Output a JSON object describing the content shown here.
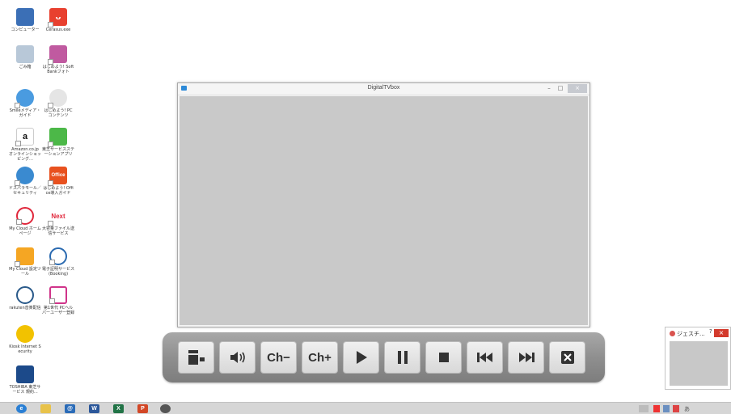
{
  "desktop": {
    "icons": [
      {
        "label": "コンピューター",
        "glyph": "",
        "color": "#3b6fb6",
        "badge": ""
      },
      {
        "label": "Cerasus.exe",
        "glyph": "ᴗ",
        "color": "#e8402f",
        "badge": "↗"
      },
      {
        "label": "ごみ箱",
        "glyph": "",
        "color": "#b8c8d8",
        "badge": ""
      },
      {
        "label": "はじめよう! SoftBankフォト",
        "glyph": "",
        "color": "#c05aa0",
        "badge": "↗"
      },
      {
        "label": "Smileメディア・ガイド",
        "glyph": "",
        "color": "#4a9be0",
        "badge": "↗"
      },
      {
        "label": "はじめよう! PCコンテンツ",
        "glyph": "",
        "color": "#e5e5e5",
        "badge": "↗"
      },
      {
        "label": "Amazon.co.jp オンラインショッピング…",
        "glyph": "a",
        "color": "#ffffff",
        "badge": "↗"
      },
      {
        "label": "東芝サービスステーションアプリ",
        "glyph": "",
        "color": "#4cb848",
        "badge": "↗"
      },
      {
        "label": "ドスパラモール／セキュリティ",
        "glyph": "",
        "color": "#3a8ad0",
        "badge": "↗"
      },
      {
        "label": "はじめよう! Office導入ガイド",
        "glyph": "",
        "color": "#e8511f",
        "badge": "↗"
      },
      {
        "label": "My Cloud ホームページ",
        "glyph": "",
        "color": "#e0283c",
        "badge": "↗"
      },
      {
        "label": "大容量ファイル送信サービス",
        "glyph": "Next",
        "color": "#ffffff",
        "badge": "↗"
      },
      {
        "label": "My Cloud 設定ツール",
        "glyph": "",
        "color": "#f5a623",
        "badge": "↗"
      },
      {
        "label": "電子証明サービス(Booking)",
        "glyph": "",
        "color": "#2a6ab0",
        "badge": "↗"
      },
      {
        "label": "rakuten音楽配信",
        "glyph": "",
        "color": "#2a5a8a",
        "badge": ""
      },
      {
        "label": "第1世代 PCヘルパーユーザー登録",
        "glyph": "",
        "color": "#d0348a",
        "badge": "↗"
      },
      {
        "label": "Kiosk Internet Security",
        "glyph": "",
        "color": "#f2c200",
        "badge": ""
      },
      {
        "label": "TOSHIBA 東芝サービス 規約...",
        "glyph": "",
        "color": "#1c4a8a",
        "badge": ""
      }
    ]
  },
  "window": {
    "title": "DigitalTVbox",
    "minimize_glyph": "–",
    "maximize_glyph": "□",
    "close_glyph": "×"
  },
  "controls": {
    "buttons": [
      {
        "name": "layout-button",
        "label": "",
        "icon": "layout-icon"
      },
      {
        "name": "volume-button",
        "label": "",
        "icon": "speaker-icon"
      },
      {
        "name": "channel-down-button",
        "label": "Ch−",
        "icon": ""
      },
      {
        "name": "channel-up-button",
        "label": "Ch+",
        "icon": ""
      },
      {
        "name": "play-button",
        "label": "",
        "icon": "play-icon"
      },
      {
        "name": "pause-button",
        "label": "",
        "icon": "pause-icon"
      },
      {
        "name": "stop-button",
        "label": "",
        "icon": "stop-icon"
      },
      {
        "name": "previous-button",
        "label": "",
        "icon": "rewind-icon"
      },
      {
        "name": "next-button",
        "label": "",
        "icon": "fast-forward-icon"
      },
      {
        "name": "close-player-button",
        "label": "",
        "icon": "close-icon"
      }
    ]
  },
  "notification": {
    "title": "ジェスチ...",
    "help_glyph": "?",
    "close_glyph": "×"
  },
  "taskbar": {
    "apps": [
      {
        "name": "ie-icon",
        "color": "#2a7fd4",
        "glyph": "e"
      },
      {
        "name": "explorer-icon",
        "color": "#e8c24a",
        "glyph": ""
      },
      {
        "name": "mail-icon",
        "color": "#2b6cb8",
        "glyph": "@"
      },
      {
        "name": "word-icon",
        "color": "#2b579a",
        "glyph": "W"
      },
      {
        "name": "excel-icon",
        "color": "#217346",
        "glyph": "X"
      },
      {
        "name": "powerpoint-icon",
        "color": "#d24726",
        "glyph": "P"
      },
      {
        "name": "tv-app-icon",
        "color": "#555555",
        "glyph": ""
      }
    ],
    "tray_text": "あ"
  }
}
